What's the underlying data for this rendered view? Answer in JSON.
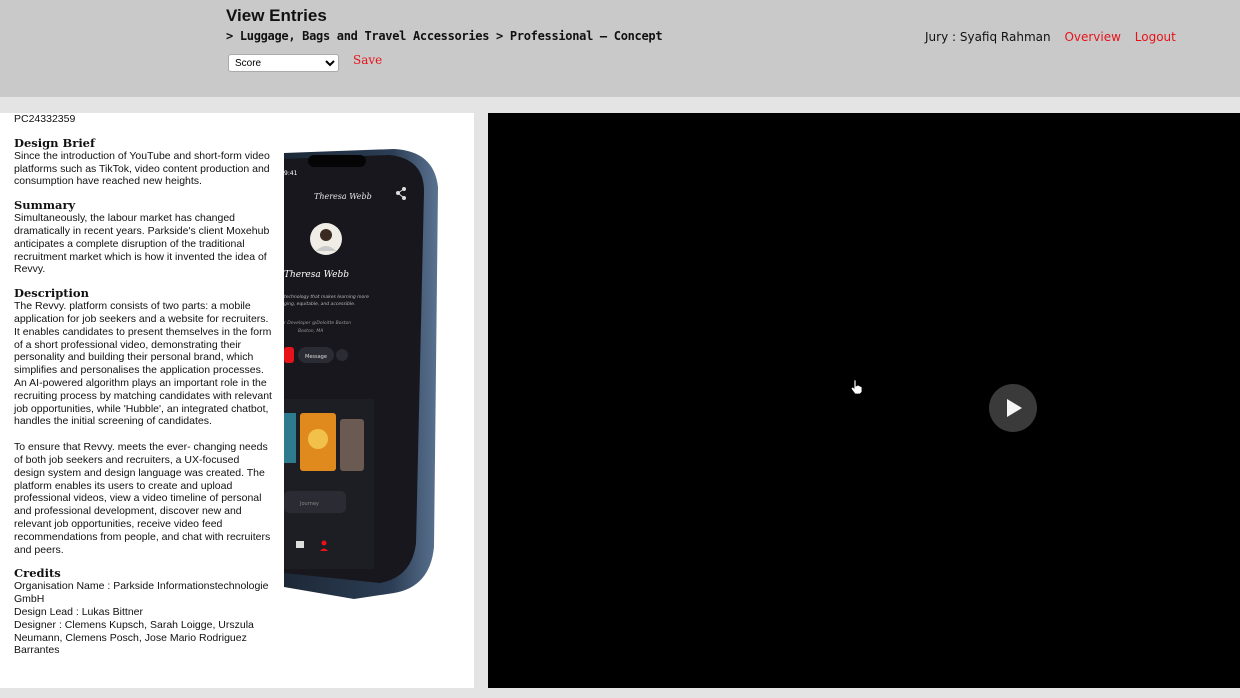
{
  "header": {
    "title": "View Entries",
    "breadcrumb": "> Luggage, Bags and Travel Accessories > Professional – Concept",
    "score_select": {
      "selected": "Score",
      "options": [
        "Score"
      ]
    },
    "save_label": "Save",
    "jury_label": "Jury : Syafiq Rahman",
    "overview_link": "Overview",
    "logout_link": "Logout"
  },
  "entry": {
    "code": "PC24332359",
    "design_brief_heading": "Design Brief",
    "design_brief": "Since the introduction of YouTube and short-form video platforms such as TikTok, video content production and consumption have reached new heights.",
    "summary_heading": "Summary",
    "summary": "Simultaneously, the labour market has changed dramatically in recent years. Parkside's client Moxehub anticipates a complete disruption of the traditional recruitment market which is how it invented the idea of Revvy.",
    "description_heading": "Description",
    "description_1": "The Revvy. platform consists of two parts: a mobile application for job seekers and a website for recruiters. It enables candidates to present themselves in the form of a short professional video, demonstrating their personality and building their personal brand, which simplifies and personalises the application processes. An AI-powered algorithm plays an important role in the recruiting process by matching candidates with relevant job opportunities, while 'Hubble', an integrated chatbot, handles the initial screening of candidates.",
    "description_2": "To ensure that Revvy. meets the ever- changing needs of both job seekers and recruiters, a UX-focused design system and design language was created. The platform enables its users to create and upload professional videos, view a video timeline of personal and professional development, discover new and relevant job opportunities, receive video feed recommendations from people, and chat with recruiters and peers.",
    "credits_heading": "Credits",
    "credit_org": "Organisation Name : Parkside Informationstechnologie GmbH",
    "credit_lead": "Design Lead : Lukas Bittner",
    "credit_designers": "Designer : Clemens Kupsch, Sarah Loigge, Urszula Neumann, Clemens Posch, Jose Mario Rodriguez Barrantes"
  },
  "phone_mock": {
    "time": "9:41",
    "profile_name": "Theresa Webb",
    "profile_card_name": "Theresa Webb",
    "tagline_1": "technology that makes learning more",
    "tagline_2": "ging, equitable, and accessible.",
    "role": "r Developer @Deloitte Boston",
    "location": "Boston, MA",
    "message_button": "Message",
    "journey_button": "Journey"
  },
  "colors": {
    "header_bg": "#c9c9c9",
    "link_red": "#e8131a",
    "video_bg": "#000000",
    "play_button_bg": "#3a3a3a"
  }
}
